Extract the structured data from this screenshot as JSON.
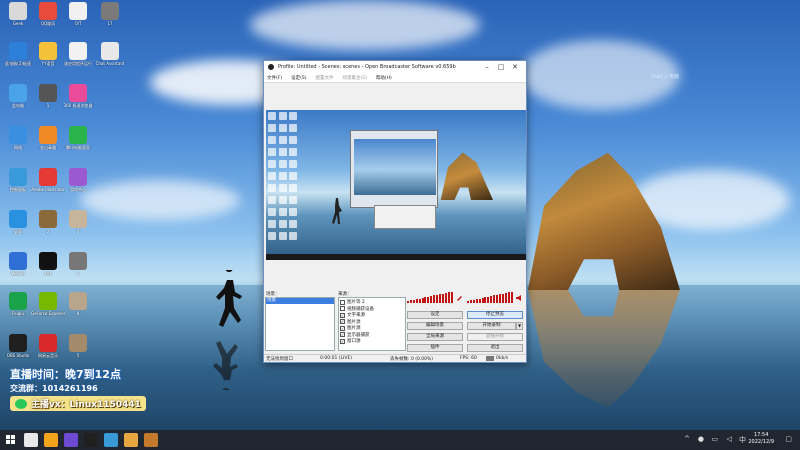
{
  "desktop": {
    "top_right_label": "Dialt 2 电脑",
    "icons": [
      {
        "label": "Geek",
        "color": "#d9d9d9"
      },
      {
        "label": "QQ旋风",
        "color": "#e84b3c"
      },
      {
        "label": "OIT",
        "color": "#f0f0f0"
      },
      {
        "label": "17",
        "color": "#7a7a7a"
      },
      {
        "label": "此电脑(2)极速",
        "color": "#2e7fd9"
      },
      {
        "label": "YY语音",
        "color": "#f3c13a"
      },
      {
        "label": "该应用程序运行",
        "color": "#f2f2f2"
      },
      {
        "label": "Chat Assistant",
        "color": "#e8e8e8"
      },
      {
        "label": "此电脑",
        "color": "#4aa3e8"
      },
      {
        "label": "1",
        "color": "#555"
      },
      {
        "label": "360 极速浏览器",
        "color": "#ea4b9b"
      },
      {
        "label": "网络",
        "color": "#3b8fe0"
      },
      {
        "label": "金山毒霸",
        "color": "#f08a24"
      },
      {
        "label": "腾讯电脑管家",
        "color": "#29b34a"
      },
      {
        "label": "控制面板",
        "color": "#3a9ad9"
      },
      {
        "label": "Adobe Illustrator",
        "color": "#e53935"
      },
      {
        "label": "游戏中心",
        "color": "#9b59d0"
      },
      {
        "label": "录屏",
        "color": "#2a90e0"
      },
      {
        "label": "2",
        "color": "#8a6a3a"
      },
      {
        "label": "4",
        "color": "#c6b59a"
      },
      {
        "label": "Weixin",
        "color": "#2f6fd6"
      },
      {
        "label": "QQ",
        "color": "#111"
      },
      {
        "label": "1",
        "color": "#777"
      },
      {
        "label": "Feiqiu",
        "color": "#1aa34a"
      },
      {
        "label": "GeForce Experience",
        "color": "#76b900"
      },
      {
        "label": "8",
        "color": "#b9a58c"
      },
      {
        "label": "OBS Studio",
        "color": "#202020"
      },
      {
        "label": "网易云音乐",
        "color": "#d8282a"
      },
      {
        "label": "5",
        "color": "#a38a6a"
      }
    ]
  },
  "overlay": {
    "line1": "直播时间：晚7到12点",
    "line2": "交流群：1014261196",
    "line3": "主播vx：Linux1150441"
  },
  "obs": {
    "title": "Profile: Untitled - Scenes: scenes - Open Broadcaster Software v0.659b",
    "menu": [
      "文件(F)",
      "设定(S)",
      "配置文件",
      "场景集合(S)",
      "帮助(H)"
    ],
    "menu_disabled": [
      false,
      false,
      true,
      true,
      false
    ],
    "scenes_label": "场景：",
    "sources_label": "来源：",
    "scene_selected": "场景",
    "sources": [
      {
        "label": "图片等 2",
        "checked": false
      },
      {
        "label": "视频捕获设备",
        "checked": false
      },
      {
        "label": "文字来源",
        "checked": true
      },
      {
        "label": "图片源",
        "checked": true
      },
      {
        "label": "图片源",
        "checked": true
      },
      {
        "label": "显示器捕获",
        "checked": true
      },
      {
        "label": "窗口源",
        "checked": true
      }
    ],
    "buttons": {
      "settings": "设定",
      "stop_preview": "停止预览",
      "edit_scene": "编辑场景",
      "start_recording": "开始录制",
      "global_sources": "全局来源",
      "start_streaming": "直播开始",
      "plugins": "插件",
      "exit": "退出"
    },
    "status": {
      "window": "无法找到窗口",
      "time": "0:00:01 (LIVE)",
      "dropped_frames": "丢失帧数: 0 (0.00%)",
      "fps": "FPS: 60",
      "bitrate": "0kb/s"
    }
  },
  "taskbar": {
    "time": "17:54",
    "date": "2022/12/9",
    "colors": [
      "#e8e8e8",
      "#f2a21b",
      "#6c4bd0",
      "#202020",
      "#3a9ad9",
      "#e8a640",
      "#c37a2d"
    ]
  }
}
